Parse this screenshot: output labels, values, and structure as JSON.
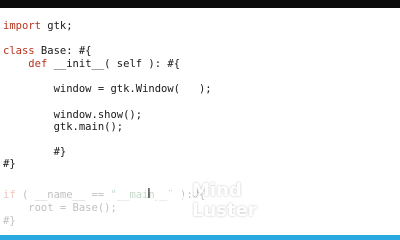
{
  "code": {
    "l1": {
      "kw": "import",
      "rest": " gtk;"
    },
    "l2": {
      "kw": "class",
      "rest": " Base: #{"
    },
    "l3": {
      "indent": "    ",
      "kw": "def",
      "rest": " __init__( self ): #{"
    },
    "l4": {
      "text": "        window = gtk.Window(   );"
    },
    "l5": {
      "text": "        window.show();"
    },
    "l6": {
      "text": "        gtk.main();"
    },
    "l7": {
      "text": "        #}"
    },
    "l8": {
      "text": "#}"
    },
    "l9a": {
      "kw": "if",
      "pre": " ( __name__ == ",
      "str": "\"__main__\"",
      "post": " ):#{"
    },
    "l10": {
      "text": "    root = Base();"
    },
    "l11": {
      "text": "#}"
    }
  },
  "logo": {
    "line1": "Mind",
    "line2": "Luster"
  },
  "colors": {
    "top_bar": "#0b0b0b",
    "bottom_bar": "#2aa9e0",
    "keyword": "#b8321e",
    "string": "#2f7a38"
  },
  "icons": {
    "cursor": "text-cursor-ibeam-icon",
    "logo_mark": "brain-circuit-icon"
  }
}
